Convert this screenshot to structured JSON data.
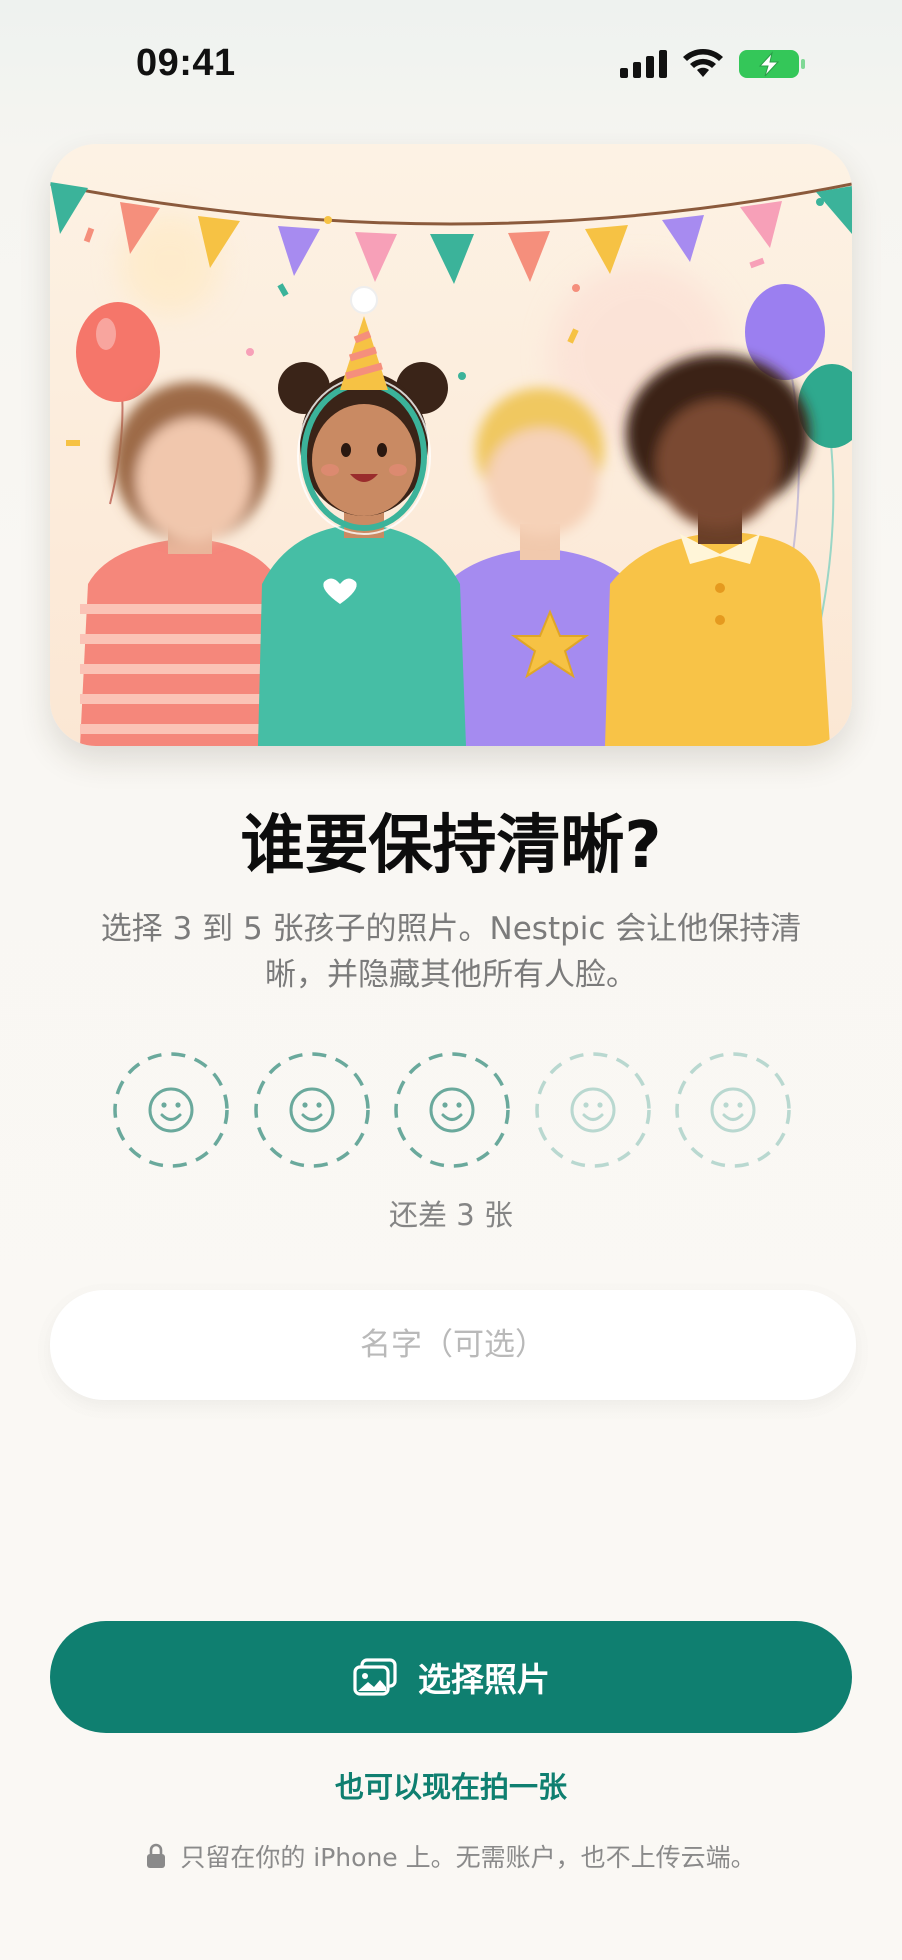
{
  "status_bar": {
    "time": "09:41",
    "icons": [
      "cellular-signal-icon",
      "wifi-icon",
      "battery-charging-icon"
    ],
    "battery_color": "#34c759"
  },
  "hero": {
    "illustration": "birthday-party-children-illustration",
    "highlighted_child": "birthday-girl-in-oval-frame"
  },
  "title": "谁要保持清晰?",
  "subtitle": "选择 3 到 5 张孩子的照片。Nestpic 会让他保持清晰，并隐藏其他所有人脸。",
  "face_slots": {
    "count": 5,
    "required": 3,
    "icon": "smiley-face-icon",
    "remaining_label": "还差 3 张"
  },
  "name_field": {
    "value": "",
    "placeholder": "名字（可选）"
  },
  "actions": {
    "choose_photos_label": "选择照片",
    "choose_photos_icon": "photo-library-icon",
    "take_photo_label": "也可以现在拍一张"
  },
  "privacy_note": {
    "icon": "lock-icon",
    "text": "只留在你的 iPhone 上。无需账户，也不上传云端。"
  },
  "colors": {
    "accent": "#0f7f70",
    "face_slot_border": "#6aa99c",
    "background": "#faf8f4"
  }
}
